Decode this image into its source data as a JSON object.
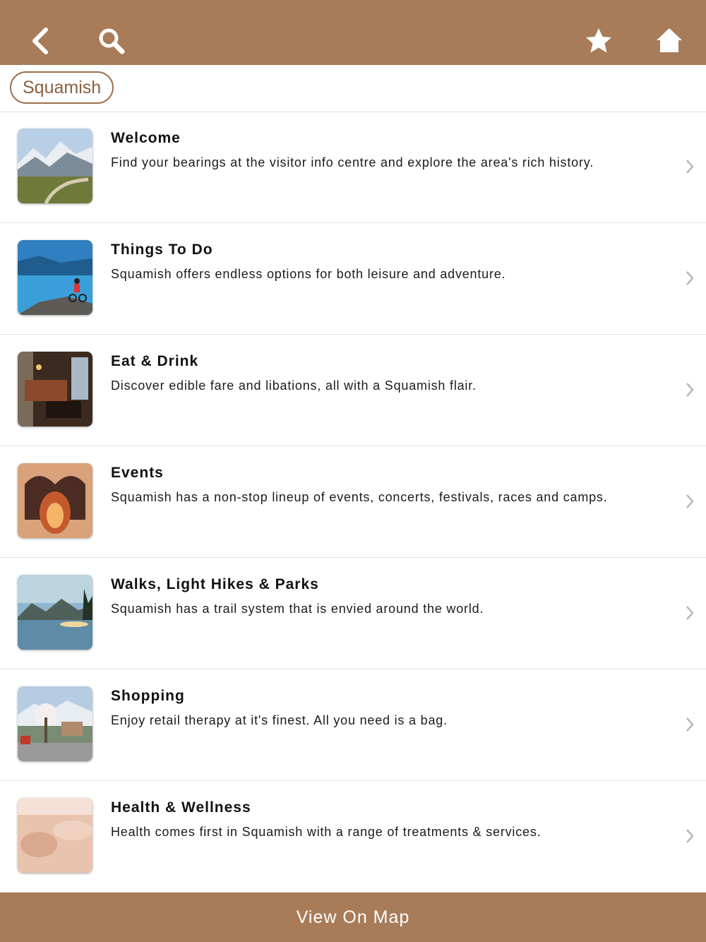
{
  "nav": {
    "back_icon": "back-chevron-icon",
    "search_icon": "search-icon",
    "favorite_icon": "star-icon",
    "home_icon": "home-icon"
  },
  "breadcrumb": {
    "label": "Squamish"
  },
  "items": [
    {
      "title": "Welcome",
      "description": "Find your bearings at the visitor info centre and explore the area's rich history."
    },
    {
      "title": "Things To Do",
      "description": "Squamish offers endless options for both leisure and adventure."
    },
    {
      "title": "Eat & Drink",
      "description": "Discover edible fare and libations, all with a Squamish flair."
    },
    {
      "title": "Events",
      "description": "Squamish has a non-stop lineup of events, concerts, festivals, races and camps."
    },
    {
      "title": "Walks, Light Hikes & Parks",
      "description": "Squamish has a trail system that is envied around the world."
    },
    {
      "title": "Shopping",
      "description": "Enjoy retail therapy at it's finest. All you need is a bag."
    },
    {
      "title": "Health & Wellness",
      "description": "Health comes first in Squamish with a range of treatments & services."
    }
  ],
  "footer": {
    "map_button_label": "View On Map"
  },
  "colors": {
    "brand": "#a87c58",
    "accent_text": "#8a6040"
  }
}
